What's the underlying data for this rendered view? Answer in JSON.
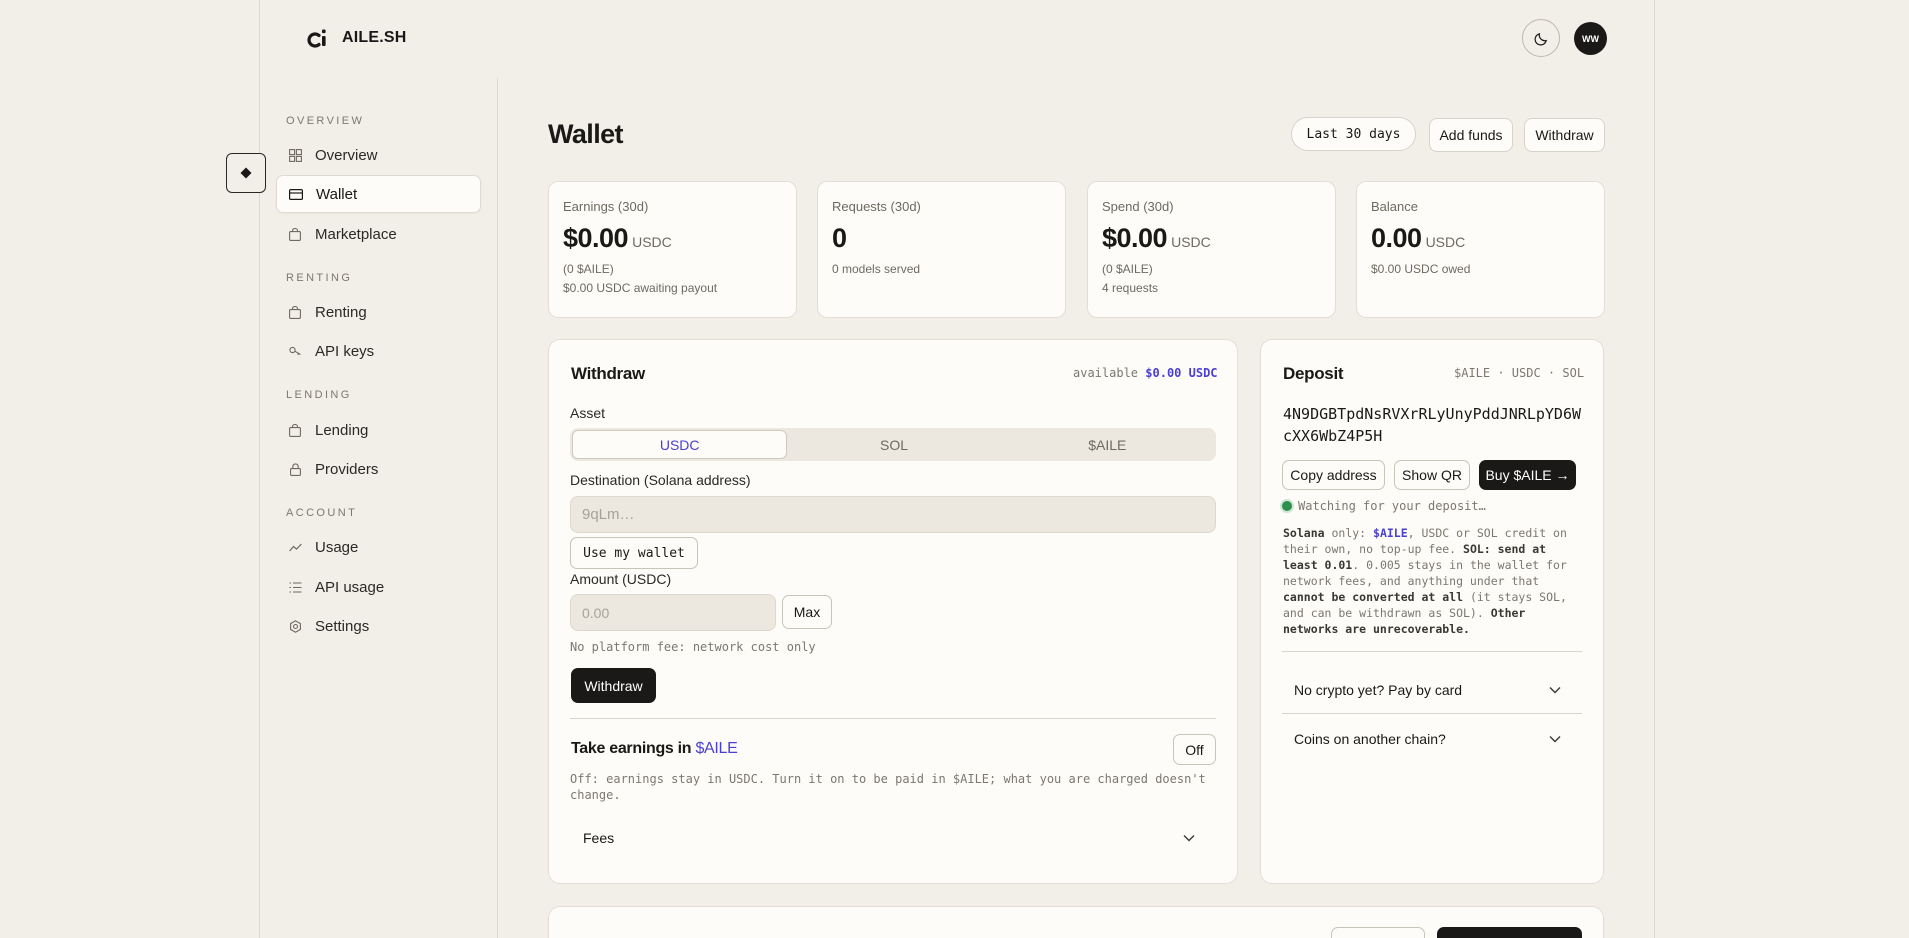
{
  "brand": {
    "name": "AILE.SH"
  },
  "header": {
    "avatar_initials": "WW"
  },
  "sidebar": {
    "sections": [
      {
        "title": "OVERVIEW"
      },
      {
        "title": "RENTING"
      },
      {
        "title": "LENDING"
      },
      {
        "title": "ACCOUNT"
      }
    ],
    "items": [
      {
        "label": "Overview",
        "icon": "dashboard-icon"
      },
      {
        "label": "Wallet",
        "icon": "wallet-icon",
        "active": true
      },
      {
        "label": "Marketplace",
        "icon": "bag-icon"
      },
      {
        "label": "Renting",
        "icon": "bag-icon"
      },
      {
        "label": "API keys",
        "icon": "key-icon"
      },
      {
        "label": "Lending",
        "icon": "bag-icon"
      },
      {
        "label": "Providers",
        "icon": "lock-icon"
      },
      {
        "label": "Usage",
        "icon": "chart-line-icon"
      },
      {
        "label": "API usage",
        "icon": "list-icon"
      },
      {
        "label": "Settings",
        "icon": "gear-icon"
      }
    ]
  },
  "page": {
    "title": "Wallet",
    "range_label": "Last 30 days",
    "add_funds_label": "Add funds",
    "withdraw_label": "Withdraw"
  },
  "stats": [
    {
      "label": "Earnings (30d)",
      "value": "$0.00",
      "unit": "USDC",
      "subs": [
        "(0 $AILE)",
        "$0.00 USDC awaiting payout"
      ]
    },
    {
      "label": "Requests (30d)",
      "value": "0",
      "unit": "",
      "subs": [
        "0 models served"
      ]
    },
    {
      "label": "Spend (30d)",
      "value": "$0.00",
      "unit": "USDC",
      "subs": [
        "(0 $AILE)",
        "4 requests"
      ]
    },
    {
      "label": "Balance",
      "value": "0.00",
      "unit": "USDC",
      "subs": [
        "$0.00 USDC owed"
      ]
    }
  ],
  "withdraw": {
    "title": "Withdraw",
    "available_prefix": "available",
    "available_value": "$0.00 USDC",
    "asset_label": "Asset",
    "assets": [
      "USDC",
      "SOL",
      "$AILE"
    ],
    "destination_label": "Destination (Solana address)",
    "destination_placeholder": "9qLm…",
    "use_wallet_label": "Use my wallet",
    "amount_label": "Amount (USDC)",
    "amount_placeholder": "0.00",
    "max_label": "Max",
    "fee_note": "No platform fee: network cost only",
    "submit_label": "Withdraw",
    "earnings_title_prefix": "Take earnings in",
    "earnings_title_token": "$AILE",
    "earnings_toggle": "Off",
    "earnings_note_1": "Off: earnings stay in USDC. Turn it on to be paid in $AILE; what you are charged doesn't",
    "earnings_note_2": "change.",
    "fees_label": "Fees"
  },
  "deposit": {
    "title": "Deposit",
    "networks": "$AILE · USDC · SOL",
    "address_line_1": "4N9DGBTpdNsRVXrRLyUnyPddJNRLpYD6W",
    "address_line_2": "cXX6WbZ4P5H",
    "copy_label": "Copy address",
    "qr_label": "Show QR",
    "buy_label": "Buy $AILE →",
    "status": "Watching for your deposit…",
    "note": {
      "p1": "Solana",
      "p2": " only: ",
      "p3": "$AILE",
      "p4": ", USDC or SOL credit on their own, no top-up fee. ",
      "p5": "SOL: send at least 0.01",
      "p6": ". 0.005 stays in the wallet for network fees, and anything under that ",
      "p7": "cannot be converted at all",
      "p8": " (it stays SOL, and can be withdrawn as SOL). ",
      "p9": "Other networks are unrecoverable."
    },
    "card_label": "No crypto yet? Pay by card",
    "chain_label": "Coins on another chain?"
  },
  "colors": {
    "accent": "#4a3fd1",
    "status_green": "#2f8f4e",
    "dark": "#1a1917"
  }
}
